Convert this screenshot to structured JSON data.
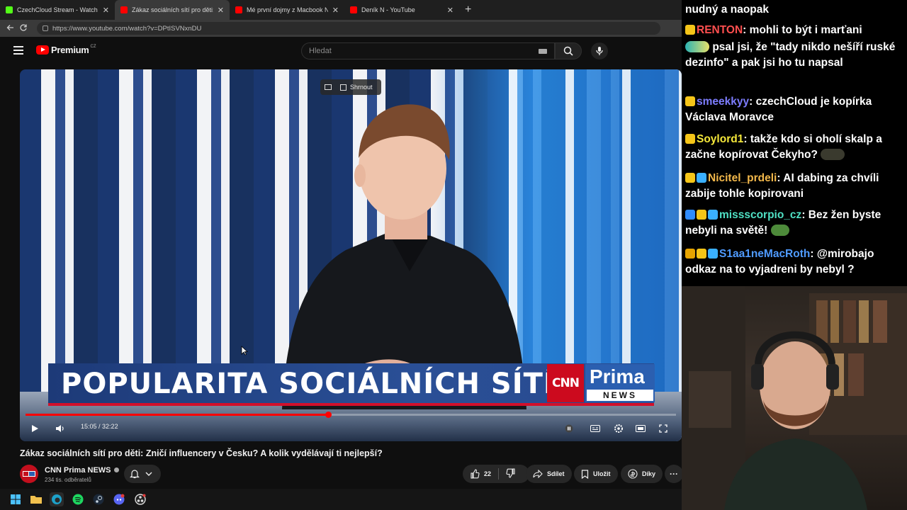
{
  "browser": {
    "tabs": [
      {
        "title": "CzechCloud Stream - Watch Live o",
        "fav_color": "#53fc18"
      },
      {
        "title": "Zákaz sociálních sítí pro děti: Zničí",
        "fav_color": "#ff0000"
      },
      {
        "title": "Mé první dojmy z Macbook Neo.",
        "fav_color": "#ff0000"
      },
      {
        "title": "Deník N - YouTube",
        "fav_color": "#ff0000"
      }
    ],
    "close_symbol": "✕",
    "newtab_symbol": "+",
    "url": "https://www.youtube.com/watch?v=DPtISVNxnDU"
  },
  "youtube": {
    "logo_word": "Premium",
    "logo_country": "CZ",
    "search_placeholder": "Hledat"
  },
  "video": {
    "pip_label": "Shrnout",
    "lower_third": "POPULARITA SOCIÁLNÍCH SÍTÍ",
    "cnn_logo": "CNN",
    "prima_logo": "Prima",
    "news_logo": "NEWS",
    "time_current": "15:05",
    "time_total": "32:22",
    "time_separator": " / ",
    "progress_fraction": 0.465,
    "icons": [
      "play-icon",
      "volume-icon",
      "pause-pip-icon",
      "subtitles-icon",
      "settings-icon",
      "theater-icon",
      "fullscreen-icon"
    ]
  },
  "title": "Zákaz sociálních sítí pro děti: Zničí influencery v Česku? A kolik vydělávají ti nejlepší?",
  "channel": {
    "avatar_text": "CNN Prima NEWS",
    "name": "CNN Prima NEWS",
    "subs": "234 tis. odběratelů"
  },
  "actions": {
    "like_count": "22",
    "share": "Sdílet",
    "save": "Uložit",
    "thanks": "Díky",
    "more": "···"
  },
  "chat": {
    "messages": [
      {
        "user": "",
        "text": "nudný a naopak"
      },
      {
        "user": "RENTON",
        "user_color": "#ff4f4f",
        "text": "mohli to být i marťani"
      },
      {
        "user": "",
        "text": "psal jsi, že \"tady nikdo nešíří ruské dezinfo\" a pak jsi ho tu napsal"
      },
      {
        "user": "smeekkyy",
        "user_color": "#7d7dff",
        "text": "czechCloud je kopírka Václava Moravce"
      },
      {
        "user": "Soylord1",
        "user_color": "#f5e83a",
        "text": "takže kdo si oholí skalp a začne kopírovat Čekyho?"
      },
      {
        "user": "Nicitel_prdeli",
        "user_color": "#f2b84b",
        "text": "AI dabing za chvíli zabije tohle kopirovani"
      },
      {
        "user": "missscorpio_cz",
        "user_color": "#4fe0c4",
        "text": "Bez žen byste nebyli na světě!"
      },
      {
        "user": "S1aa1neMacRoth",
        "user_color": "#4f9bff",
        "text": "@mirobajo odkaz na to vyjadreni by nebyl ?"
      }
    ],
    "colon": ":"
  },
  "colors": {
    "accent_red": "#ff0000",
    "pill_bg": "#272727",
    "bg": "#0f0f0f"
  }
}
